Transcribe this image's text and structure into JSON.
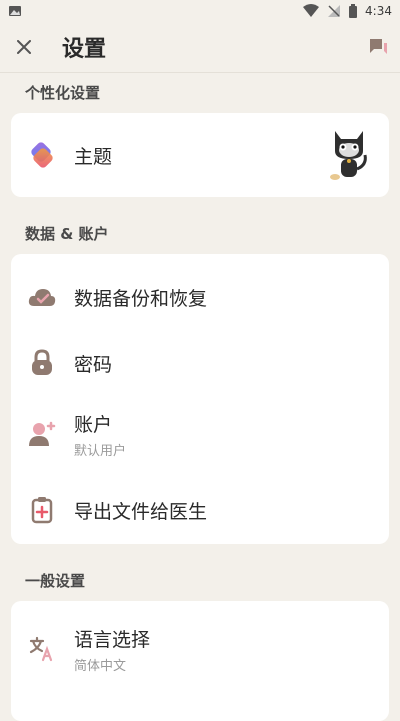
{
  "status": {
    "time": "4:34"
  },
  "header": {
    "title": "设置"
  },
  "sections": {
    "personalization": {
      "title": "个性化设置",
      "theme_label": "主题"
    },
    "data_account": {
      "title": "数据 & 账户",
      "backup_label": "数据备份和恢复",
      "password_label": "密码",
      "account_label": "账户",
      "account_sub": "默认用户",
      "export_label": "导出文件给医生"
    },
    "general": {
      "title": "一般设置",
      "language_label": "语言选择",
      "language_sub": "简体中文"
    }
  },
  "colors": {
    "background": "#f3f0ea",
    "accent_pink": "#e8a3ad",
    "icon_brown": "#8f7a70",
    "title_brown": "#2a2a2a"
  }
}
